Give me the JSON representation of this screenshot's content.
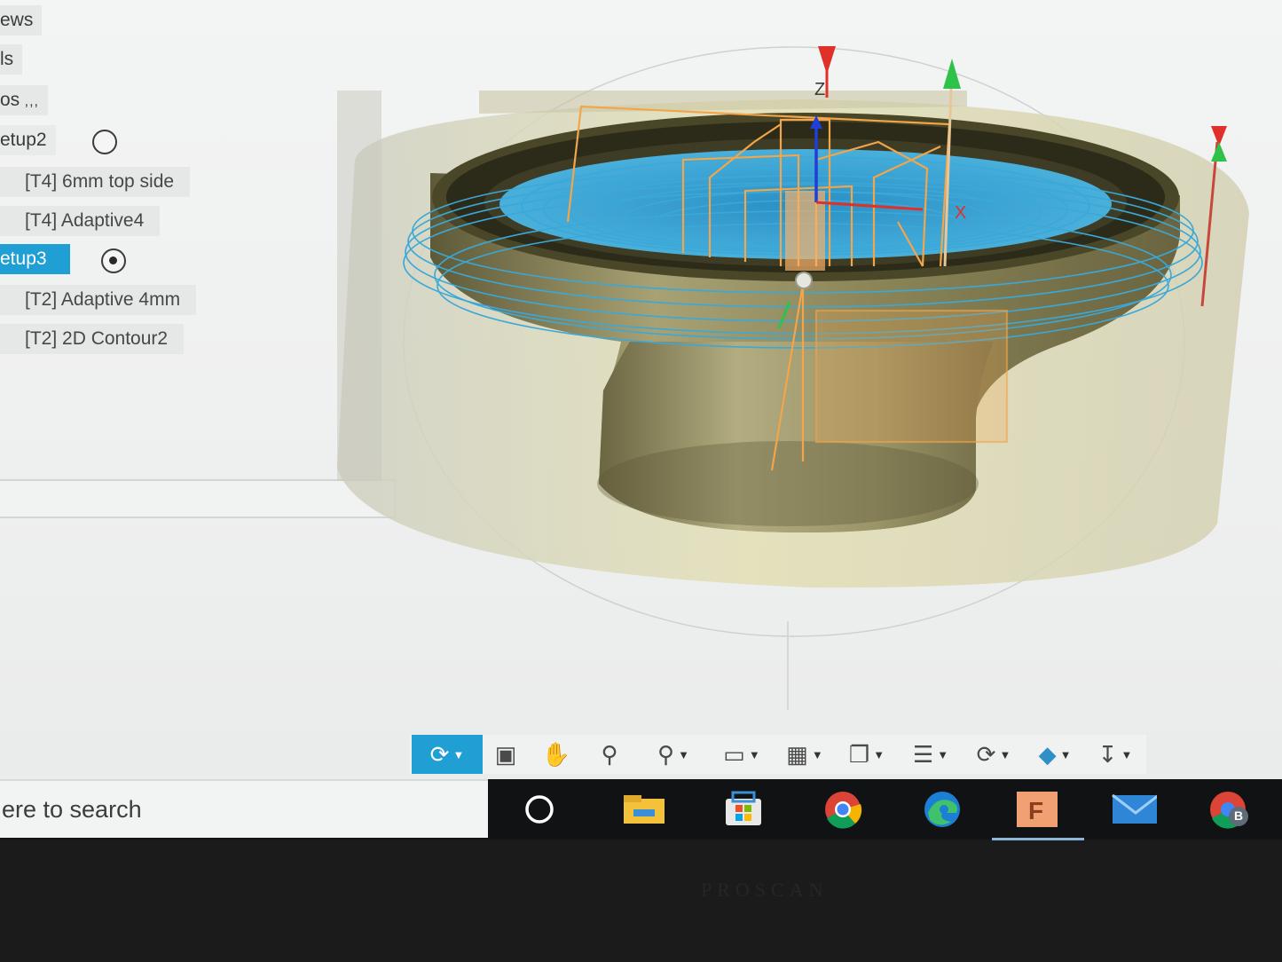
{
  "browser": {
    "rows": [
      {
        "label": "ews",
        "kind": "folder"
      },
      {
        "label": "ls",
        "kind": "folder"
      },
      {
        "label": "os",
        "kind": "folder"
      },
      {
        "label": "etup2",
        "kind": "setup",
        "active": false
      },
      {
        "label": "[T4] 6mm top side",
        "kind": "operation"
      },
      {
        "label": "[T4] Adaptive4",
        "kind": "operation"
      },
      {
        "label": "etup3",
        "kind": "setup",
        "active": true
      },
      {
        "label": "[T2] Adaptive 4mm",
        "kind": "operation"
      },
      {
        "label": "[T2] 2D Contour2",
        "kind": "operation"
      }
    ]
  },
  "viewport": {
    "axis_labels": {
      "z": "Z",
      "x": "X"
    },
    "colors": {
      "stock": "#d9d4a8",
      "part": "#8c855a",
      "toolpath_orange": "#f2a54a",
      "toolpath_blue": "#3aa8d8",
      "axis_z": "#e0302a",
      "axis_y": "#2fc24a",
      "axis_x": "#1f3fd6"
    }
  },
  "nav_toolbar": {
    "tools": [
      {
        "icon": "orbit-icon",
        "selected": true,
        "has_menu": true
      },
      {
        "icon": "look-at-icon",
        "selected": false,
        "has_menu": false
      },
      {
        "icon": "pan-hand-icon",
        "selected": false,
        "has_menu": false
      },
      {
        "icon": "zoom-icon",
        "selected": false,
        "has_menu": false
      },
      {
        "icon": "fit-zoom-icon",
        "selected": false,
        "has_menu": true
      },
      {
        "icon": "display-settings-icon",
        "selected": false,
        "has_menu": true
      },
      {
        "icon": "grid-icon",
        "selected": false,
        "has_menu": true
      },
      {
        "icon": "viewports-icon",
        "selected": false,
        "has_menu": true
      },
      {
        "icon": "layers-icon",
        "selected": false,
        "has_menu": true
      },
      {
        "icon": "refresh-icon",
        "selected": false,
        "has_menu": true
      },
      {
        "icon": "stock-display-icon",
        "selected": false,
        "has_menu": true
      },
      {
        "icon": "tool-display-icon",
        "selected": false,
        "has_menu": true
      }
    ]
  },
  "taskbar": {
    "search_placeholder": "ere to search",
    "apps": [
      "cortana-icon",
      "file-explorer-icon",
      "microsoft-store-icon",
      "chrome-icon",
      "edge-icon",
      "fusion-icon",
      "mail-icon",
      "chrome-profile-icon"
    ],
    "chrome_profile_letter": "B"
  },
  "monitor": {
    "brand": "PROSCAN"
  }
}
